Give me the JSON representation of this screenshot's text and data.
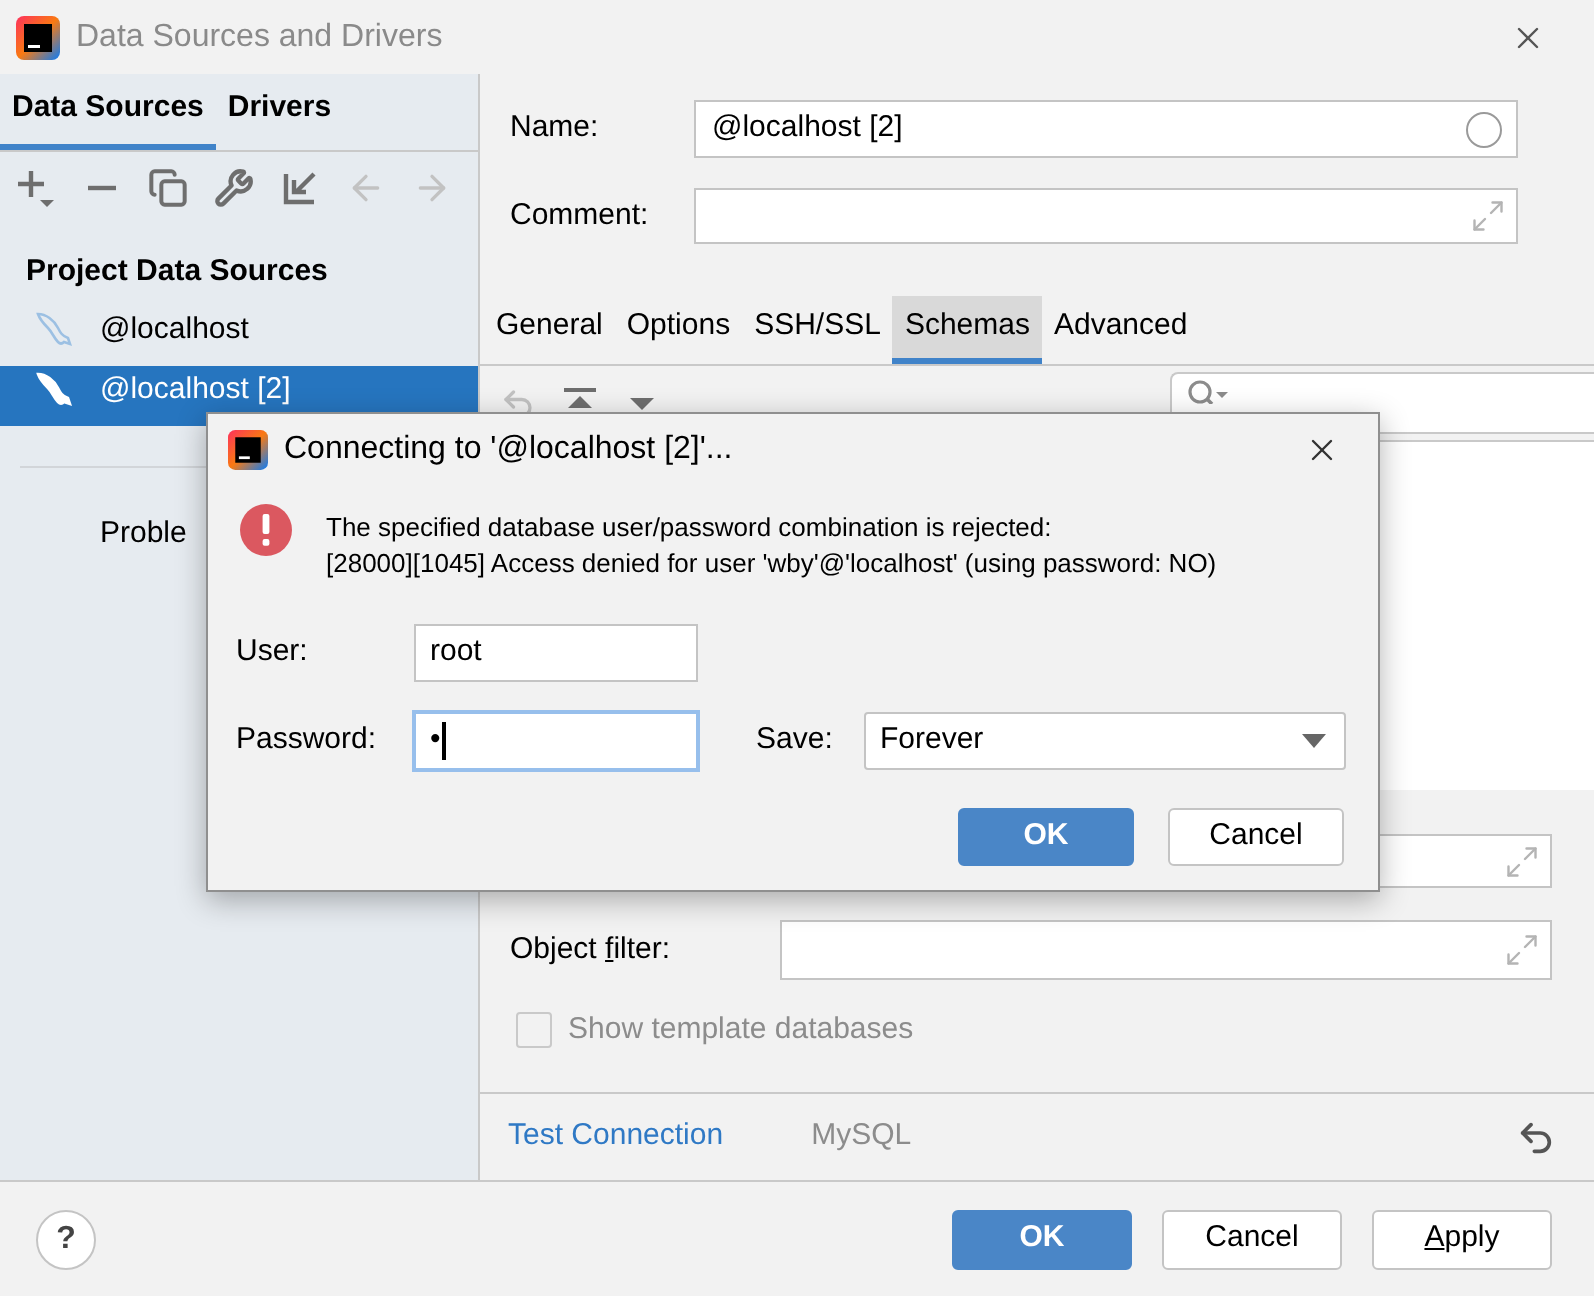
{
  "window": {
    "title": "Data Sources and Drivers"
  },
  "left_panel": {
    "tabs": [
      {
        "label": "Data Sources",
        "selected": true
      },
      {
        "label": "Drivers",
        "selected": false
      }
    ],
    "toolbar": [
      {
        "kind": "add",
        "disabled": false
      },
      {
        "kind": "remove",
        "disabled": false
      },
      {
        "kind": "duplicate",
        "disabled": false
      },
      {
        "kind": "properties",
        "disabled": false
      },
      {
        "kind": "import",
        "disabled": false
      },
      {
        "kind": "back",
        "disabled": true
      },
      {
        "kind": "forward",
        "disabled": true
      }
    ],
    "section_title": "Project Data Sources",
    "items": [
      {
        "label": "@localhost",
        "selected": false
      },
      {
        "label": "@localhost [2]",
        "selected": true
      }
    ],
    "cut_label": "Proble"
  },
  "right_panel": {
    "name": {
      "label": "Name:",
      "value": "@localhost [2]"
    },
    "comment": {
      "label": "Comment:"
    },
    "tabs": [
      {
        "label": "General",
        "selected": false
      },
      {
        "label": "Options",
        "selected": false
      },
      {
        "label": "SSH/SSL",
        "selected": false
      },
      {
        "label": "Schemas",
        "selected": true
      },
      {
        "label": "Advanced",
        "selected": false
      }
    ],
    "schemas_toolbar": [
      {
        "kind": "revert",
        "disabled": true
      },
      {
        "kind": "move-top",
        "disabled": false
      },
      {
        "kind": "move-bottom",
        "disabled": false
      }
    ],
    "object_filter": {
      "label": "Object filter:",
      "mnemonic_underlined": true
    },
    "show_template_databases": {
      "label": "Show template databases",
      "checked": false,
      "disabled": true
    },
    "test_connection": "Test Connection",
    "driver": "MySQL"
  },
  "footer": {
    "help": "?",
    "buttons": [
      {
        "label": "OK",
        "kind": "primary"
      },
      {
        "label": "Cancel",
        "kind": "default"
      },
      {
        "label": "Apply",
        "kind": "default",
        "mnemonic_underlined": true
      }
    ]
  },
  "dialog": {
    "title": "Connecting to '@localhost [2]'...",
    "message": [
      "The specified database user/password combination is rejected:",
      "[28000][1045] Access denied for user 'wby'@'localhost' (using password: NO)"
    ],
    "user": {
      "label": "User:",
      "value": "root"
    },
    "password": {
      "label": "Password:",
      "value": "•",
      "focused": true
    },
    "save": {
      "label": "Save:",
      "value": "Forever"
    },
    "buttons": [
      {
        "label": "OK",
        "kind": "primary"
      },
      {
        "label": "Cancel",
        "kind": "default"
      }
    ]
  }
}
